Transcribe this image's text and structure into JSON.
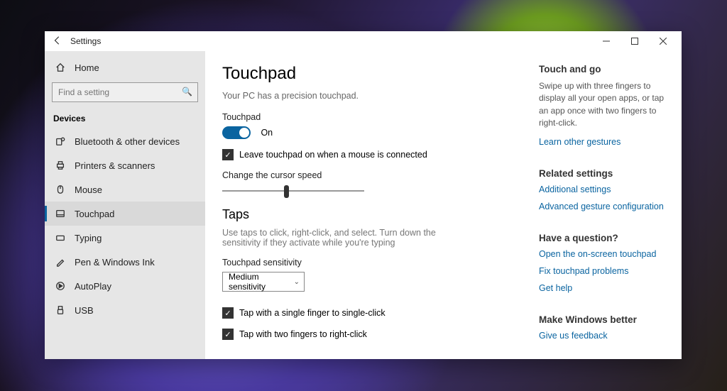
{
  "window": {
    "title": "Settings"
  },
  "sidebar": {
    "home": "Home",
    "search_placeholder": "Find a setting",
    "section": "Devices",
    "items": [
      {
        "label": "Bluetooth & other devices",
        "icon": "bluetooth"
      },
      {
        "label": "Printers & scanners",
        "icon": "printer"
      },
      {
        "label": "Mouse",
        "icon": "mouse"
      },
      {
        "label": "Touchpad",
        "icon": "touchpad",
        "selected": true
      },
      {
        "label": "Typing",
        "icon": "keyboard"
      },
      {
        "label": "Pen & Windows Ink",
        "icon": "pen"
      },
      {
        "label": "AutoPlay",
        "icon": "autoplay"
      },
      {
        "label": "USB",
        "icon": "usb"
      }
    ]
  },
  "content": {
    "title": "Touchpad",
    "precision_text": "Your PC has a precision touchpad.",
    "toggle_label": "Touchpad",
    "toggle_state": "On",
    "leave_on_label": "Leave touchpad on when a mouse is connected",
    "cursor_speed_label": "Change the cursor speed",
    "cursor_speed_value_pct": 45,
    "taps_heading": "Taps",
    "taps_desc": "Use taps to click, right-click, and select. Turn down the sensitivity if they activate while you're typing",
    "sensitivity_label": "Touchpad sensitivity",
    "sensitivity_value": "Medium sensitivity",
    "tap_single": "Tap with a single finger to single-click",
    "tap_double": "Tap with two fingers to right-click"
  },
  "right": {
    "touch_go_head": "Touch and go",
    "touch_go_text": "Swipe up with three fingers to display all your open apps, or tap an app once with two fingers to right-click.",
    "learn_gestures": "Learn other gestures",
    "related_head": "Related settings",
    "additional": "Additional settings",
    "advanced": "Advanced gesture configuration",
    "question_head": "Have a question?",
    "open_onscreen": "Open the on-screen touchpad",
    "fix_problems": "Fix touchpad problems",
    "get_help": "Get help",
    "better_head": "Make Windows better",
    "feedback": "Give us feedback"
  }
}
